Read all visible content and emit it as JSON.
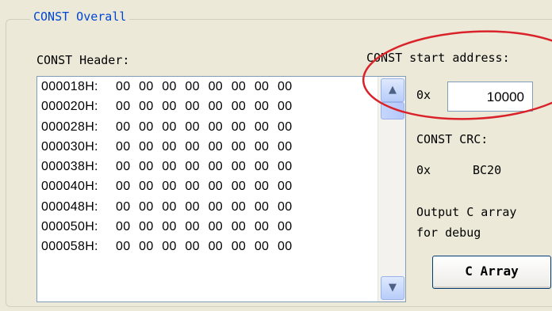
{
  "group": {
    "title": "CONST Overall"
  },
  "header_label": "CONST Header:",
  "hex_rows": [
    {
      "addr": "000018H:",
      "bytes": "00 00 00 00 00 00 00 00"
    },
    {
      "addr": "000020H:",
      "bytes": "00 00 00 00 00 00 00 00"
    },
    {
      "addr": "000028H:",
      "bytes": "00 00 00 00 00 00 00 00"
    },
    {
      "addr": "000030H:",
      "bytes": "00 00 00 00 00 00 00 00"
    },
    {
      "addr": "000038H:",
      "bytes": "00 00 00 00 00 00 00 00"
    },
    {
      "addr": "000040H:",
      "bytes": "00 00 00 00 00 00 00 00"
    },
    {
      "addr": "000048H:",
      "bytes": "00 00 00 00 00 00 00 00"
    },
    {
      "addr": "000050H:",
      "bytes": "00 00 00 00 00 00 00 00"
    },
    {
      "addr": "000058H:",
      "bytes": "00 00 00 00 00 00 00 00"
    }
  ],
  "scrollbar": {
    "up_icon": "scroll-up-arrow-icon",
    "down_icon": "scroll-down-arrow-icon"
  },
  "start_address": {
    "label": "CONST start address:",
    "prefix": "0x",
    "value": "10000"
  },
  "crc": {
    "label": "CONST CRC:",
    "prefix": "0x",
    "value": "BC20"
  },
  "output_note": {
    "line1": "Output C array",
    "line2": "for debug"
  },
  "carray_button": {
    "label": "C Array"
  },
  "annotation": {
    "shape": "red-ellipse",
    "color": "#d9222a"
  }
}
